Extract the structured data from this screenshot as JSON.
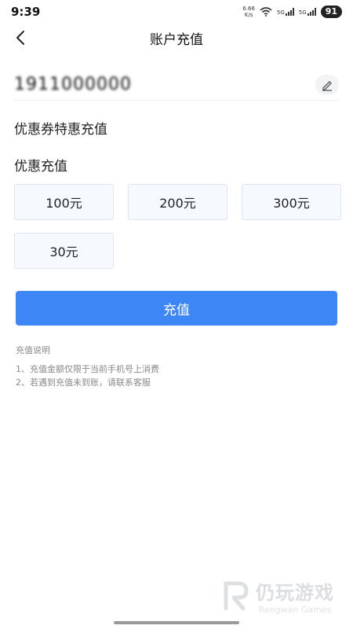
{
  "status_bar": {
    "time": "9:39",
    "net_speed_value": "6.66",
    "net_speed_unit": "K/s",
    "signal1_label": "5G",
    "signal2_label": "5G",
    "battery": "91"
  },
  "header": {
    "title": "账户充值"
  },
  "account": {
    "phone_number": "1911000000"
  },
  "coupon": {
    "title": "优惠券特惠充值"
  },
  "discount": {
    "title": "优惠充值",
    "amounts": [
      "100元",
      "200元",
      "300元",
      "30元"
    ]
  },
  "recharge_button": {
    "label": "充值",
    "color": "#3d86f5"
  },
  "notes": {
    "title": "充值说明",
    "lines": [
      "1、充值金额仅限于当前手机号上消费",
      "2、若遇到充值未到账，请联系客服"
    ]
  },
  "watermark": {
    "cn": "仍玩游戏",
    "en": "Rengwan Games"
  }
}
